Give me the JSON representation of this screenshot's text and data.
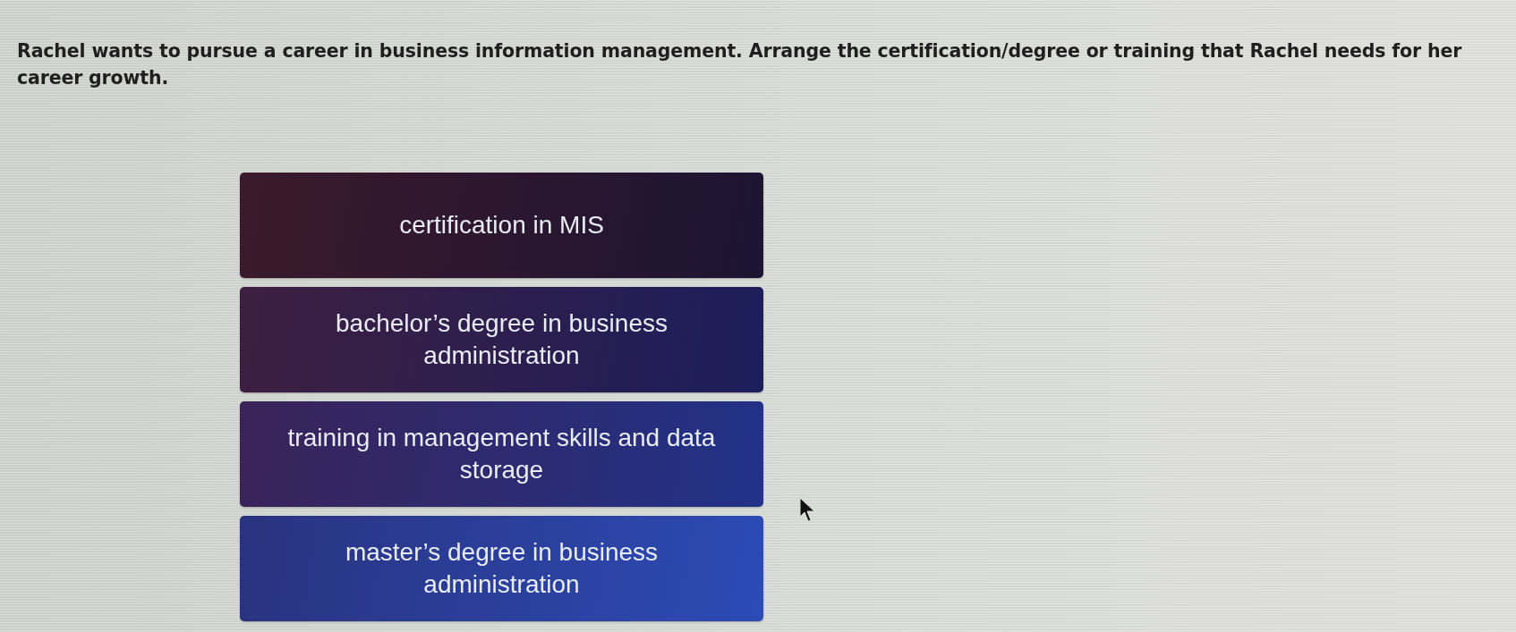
{
  "question": {
    "text": "Rachel wants to pursue a career in business information management. Arrange the certification/degree or training that Rachel needs for her career growth."
  },
  "tiles": [
    {
      "label": "certification in MIS"
    },
    {
      "label": "bachelor’s degree in business administration"
    },
    {
      "label": "training in management skills and data storage"
    },
    {
      "label": "master’s degree in business administration"
    }
  ]
}
